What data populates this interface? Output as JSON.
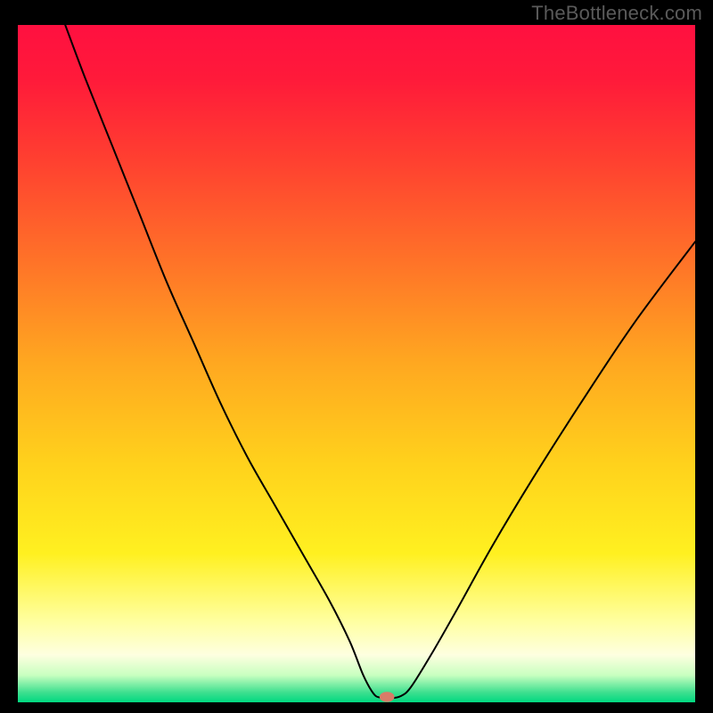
{
  "watermark": "TheBottleneck.com",
  "chart_data": {
    "type": "line",
    "title": "",
    "xlabel": "",
    "ylabel": "",
    "xlim": [
      0,
      100
    ],
    "ylim": [
      0,
      100
    ],
    "background_gradient": {
      "stops": [
        {
          "offset": 0.0,
          "color": "#ff1040"
        },
        {
          "offset": 0.08,
          "color": "#ff1a3a"
        },
        {
          "offset": 0.2,
          "color": "#ff4030"
        },
        {
          "offset": 0.35,
          "color": "#ff7328"
        },
        {
          "offset": 0.5,
          "color": "#ffa820"
        },
        {
          "offset": 0.65,
          "color": "#ffd21c"
        },
        {
          "offset": 0.78,
          "color": "#fff020"
        },
        {
          "offset": 0.88,
          "color": "#ffffa0"
        },
        {
          "offset": 0.93,
          "color": "#feffe0"
        },
        {
          "offset": 0.96,
          "color": "#c8ffc0"
        },
        {
          "offset": 0.985,
          "color": "#40e090"
        },
        {
          "offset": 1.0,
          "color": "#00d880"
        }
      ]
    },
    "series": [
      {
        "name": "bottleneck-curve",
        "x": [
          7,
          10,
          14,
          18,
          22,
          26,
          30,
          34,
          38,
          42,
          46,
          49,
          51,
          52.5,
          53.5,
          55,
          56.5,
          58,
          61,
          65,
          70,
          76,
          83,
          91,
          100
        ],
        "y": [
          100,
          92,
          82,
          72,
          62,
          53,
          44,
          36,
          29,
          22,
          15,
          9,
          4,
          1.3,
          0.7,
          0.6,
          0.9,
          2.2,
          7,
          14,
          23,
          33,
          44,
          56,
          68
        ]
      }
    ],
    "marker": {
      "name": "optimal-point",
      "x": 54.5,
      "y": 0.8,
      "rx": 1.1,
      "ry": 0.75,
      "color": "#d97c68"
    }
  }
}
